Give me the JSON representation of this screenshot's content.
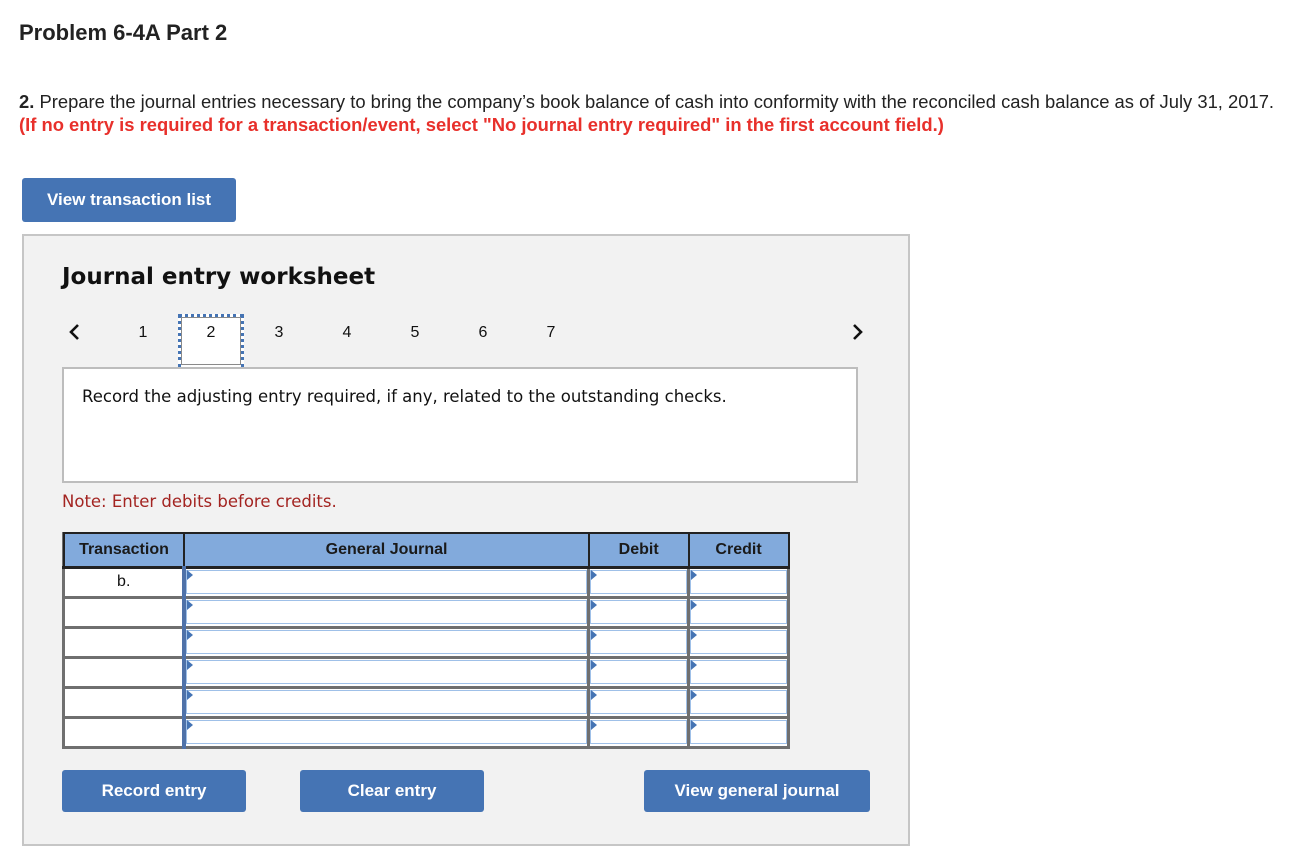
{
  "page": {
    "title": "Problem 6-4A Part 2",
    "instructions": {
      "number": "2.",
      "text": " Prepare the journal entries necessary to bring the company’s book balance of cash into conformity with the reconciled cash balance as of July 31, 2017. ",
      "warning": "(If no entry is required for a transaction/event, select \"No journal entry required\" in the first account field.)"
    },
    "view_transaction_list_label": "View transaction list"
  },
  "worksheet": {
    "title": "Journal entry worksheet",
    "nav": {
      "prev_icon": "chevron-left-icon",
      "next_icon": "chevron-right-icon",
      "pages": [
        "1",
        "2",
        "3",
        "4",
        "5",
        "6",
        "7"
      ],
      "active_page": "2"
    },
    "prompt": "Record the adjusting entry required, if any, related to the outstanding checks.",
    "note": "Note: Enter debits before credits.",
    "table": {
      "headers": {
        "transaction": "Transaction",
        "general_journal": "General Journal",
        "debit": "Debit",
        "credit": "Credit"
      },
      "rows": [
        {
          "transaction": "b.",
          "account": "",
          "debit": "",
          "credit": ""
        },
        {
          "transaction": "",
          "account": "",
          "debit": "",
          "credit": ""
        },
        {
          "transaction": "",
          "account": "",
          "debit": "",
          "credit": ""
        },
        {
          "transaction": "",
          "account": "",
          "debit": "",
          "credit": ""
        },
        {
          "transaction": "",
          "account": "",
          "debit": "",
          "credit": ""
        },
        {
          "transaction": "",
          "account": "",
          "debit": "",
          "credit": ""
        }
      ]
    },
    "buttons": {
      "record": "Record entry",
      "clear": "Clear entry",
      "view_general_journal": "View general journal"
    }
  },
  "colors": {
    "button_blue": "#4574b4",
    "warning_red": "#e8302b",
    "note_red": "#a32421",
    "header_blue": "#82aadc",
    "panel_bg": "#f2f2f2"
  }
}
